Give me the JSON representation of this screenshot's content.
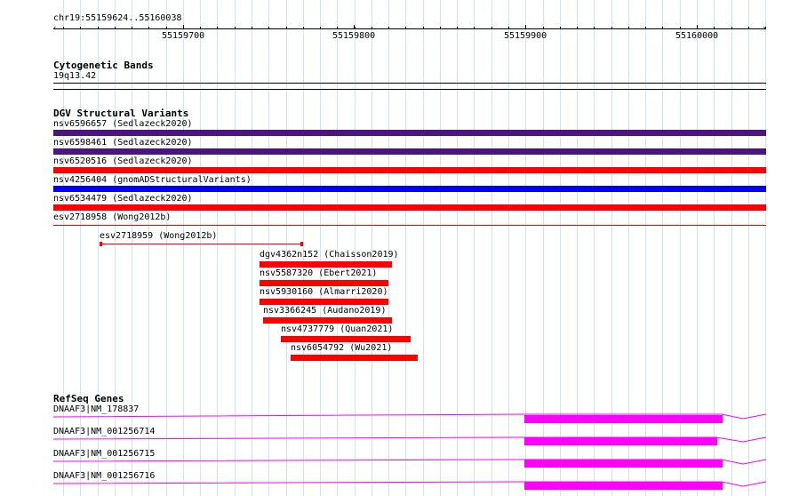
{
  "ruler": {
    "location": "chr19:55159624..55160038",
    "ticks": [
      "55159700",
      "55159800",
      "55159900",
      "55160000"
    ]
  },
  "cytobands": {
    "title": "Cytogenetic Bands",
    "band": "19q13.42"
  },
  "dgv": {
    "title": "DGV Structural Variants",
    "features": [
      {
        "label": "nsv6596657 (Sedlazeck2020)",
        "color": "#4b1483"
      },
      {
        "label": "nsv6598461 (Sedlazeck2020)",
        "color": "#4b1483"
      },
      {
        "label": "nsv6520516 (Sedlazeck2020)",
        "color": "#ff0000"
      },
      {
        "label": "nsv4256404 (gnomADStructuralVariants)",
        "color": "#0000ff"
      },
      {
        "label": "nsv6534479 (Sedlazeck2020)",
        "color": "#ff0000"
      },
      {
        "label": "esv2718958 (Wong2012b)",
        "color": "#ff0000"
      },
      {
        "label": "esv2718959 (Wong2012b)",
        "color": "#ff0000"
      },
      {
        "label": "dgv4362n152 (Chaisson2019)",
        "color": "#ff0000"
      },
      {
        "label": "nsv5587320 (Ebert2021)",
        "color": "#ff0000"
      },
      {
        "label": "nsv5930160 (Almarri2020)",
        "color": "#ff0000"
      },
      {
        "label": "nsv3366245 (Audano2019)",
        "color": "#ff0000"
      },
      {
        "label": "nsv4737779 (Quan2021)",
        "color": "#ff0000"
      },
      {
        "label": "nsv6054792 (Wu2021)",
        "color": "#ff0000"
      }
    ]
  },
  "refseq": {
    "title": "RefSeq Genes",
    "exon_color": "#ff00ff",
    "transcripts": [
      {
        "label": "DNAAF3|NM_178837"
      },
      {
        "label": "DNAAF3|NM_001256714"
      },
      {
        "label": "DNAAF3|NM_001256715"
      },
      {
        "label": "DNAAF3|NM_001256716"
      }
    ]
  }
}
